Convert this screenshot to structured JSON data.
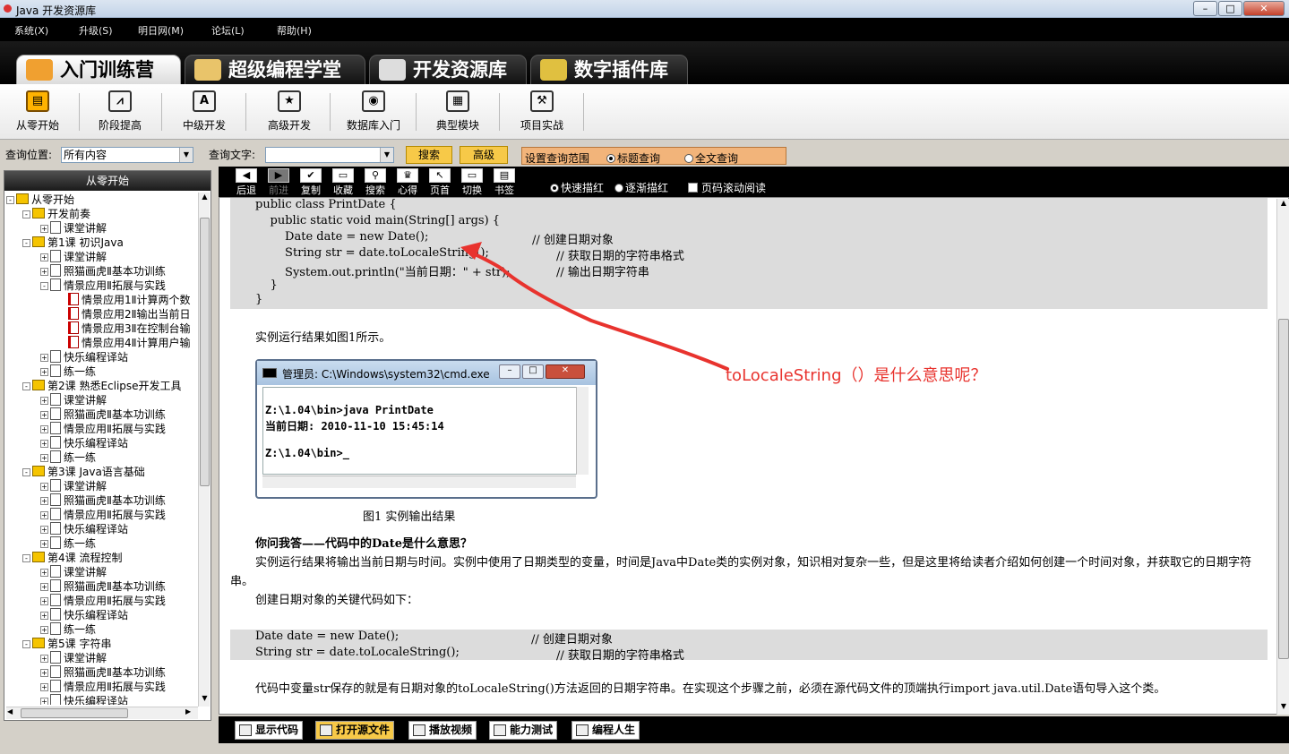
{
  "window": {
    "title": "Java 开发资源库",
    "controls": [
      "–",
      "□",
      "✕"
    ]
  },
  "menubar": {
    "items": [
      "系统(X)",
      "升级(S)",
      "明日网(M)",
      "论坛(L)",
      "帮助(H)"
    ]
  },
  "main_tabs": [
    {
      "label": "入门训练营",
      "active": true
    },
    {
      "label": "超级编程学堂",
      "active": false
    },
    {
      "label": "开发资源库",
      "active": false
    },
    {
      "label": "数字插件库",
      "active": false
    }
  ],
  "toolbar": {
    "buttons": [
      {
        "label": "从零开始",
        "icon": "book-icon",
        "glyph": "▤",
        "active": true
      },
      {
        "label": "阶段提高",
        "icon": "chart-icon",
        "glyph": "⩘"
      },
      {
        "label": "中级开发",
        "icon": "document-icon",
        "glyph": "A"
      },
      {
        "label": "高级开发",
        "icon": "stars-icon",
        "glyph": "★"
      },
      {
        "label": "数据库入门",
        "icon": "database-icon",
        "glyph": "◉"
      },
      {
        "label": "典型模块",
        "icon": "module-icon",
        "glyph": "▦"
      },
      {
        "label": "项目实战",
        "icon": "tools-icon",
        "glyph": "⚒"
      }
    ]
  },
  "search": {
    "location_label": "查询位置:",
    "location_value": "所有内容",
    "text_label": "查询文字:",
    "text_value": "",
    "search_button": "搜索",
    "advanced_button": "高级",
    "scope_label": "设置查询范围",
    "scope_options": [
      {
        "label": "标题查询",
        "selected": true
      },
      {
        "label": "全文查询",
        "selected": false
      }
    ]
  },
  "left_panel": {
    "header": "从零开始",
    "tree": [
      {
        "level": 0,
        "toggle": "-",
        "icon": "home",
        "text": "从零开始"
      },
      {
        "level": 1,
        "toggle": "-",
        "icon": "book",
        "text": "开发前奏"
      },
      {
        "level": 2,
        "toggle": "+",
        "icon": "doc",
        "text": "课堂讲解"
      },
      {
        "level": 1,
        "toggle": "-",
        "icon": "book",
        "text": "第1课  初识Java"
      },
      {
        "level": 2,
        "toggle": "+",
        "icon": "doc",
        "text": "课堂讲解"
      },
      {
        "level": 2,
        "toggle": "+",
        "icon": "doc",
        "text": "照猫画虎Ⅱ基本功训练"
      },
      {
        "level": 2,
        "toggle": "-",
        "icon": "doc",
        "text": "情景应用Ⅱ拓展与实践"
      },
      {
        "level": 3,
        "toggle": "",
        "icon": "red",
        "text": "情景应用1Ⅱ计算两个数"
      },
      {
        "level": 3,
        "toggle": "",
        "icon": "red",
        "text": "情景应用2Ⅱ输出当前日"
      },
      {
        "level": 3,
        "toggle": "",
        "icon": "red",
        "text": "情景应用3Ⅱ在控制台输"
      },
      {
        "level": 3,
        "toggle": "",
        "icon": "red",
        "text": "情景应用4Ⅱ计算用户输"
      },
      {
        "level": 2,
        "toggle": "+",
        "icon": "doc",
        "text": "快乐编程译站"
      },
      {
        "level": 2,
        "toggle": "+",
        "icon": "doc",
        "text": "练一练"
      },
      {
        "level": 1,
        "toggle": "-",
        "icon": "book",
        "text": "第2课  熟悉Eclipse开发工具"
      },
      {
        "level": 2,
        "toggle": "+",
        "icon": "doc",
        "text": "课堂讲解"
      },
      {
        "level": 2,
        "toggle": "+",
        "icon": "doc",
        "text": "照猫画虎Ⅱ基本功训练"
      },
      {
        "level": 2,
        "toggle": "+",
        "icon": "doc",
        "text": "情景应用Ⅱ拓展与实践"
      },
      {
        "level": 2,
        "toggle": "+",
        "icon": "doc",
        "text": "快乐编程译站"
      },
      {
        "level": 2,
        "toggle": "+",
        "icon": "doc",
        "text": "练一练"
      },
      {
        "level": 1,
        "toggle": "-",
        "icon": "book",
        "text": "第3课  Java语言基础"
      },
      {
        "level": 2,
        "toggle": "+",
        "icon": "doc",
        "text": "课堂讲解"
      },
      {
        "level": 2,
        "toggle": "+",
        "icon": "doc",
        "text": "照猫画虎Ⅱ基本功训练"
      },
      {
        "level": 2,
        "toggle": "+",
        "icon": "doc",
        "text": "情景应用Ⅱ拓展与实践"
      },
      {
        "level": 2,
        "toggle": "+",
        "icon": "doc",
        "text": "快乐编程译站"
      },
      {
        "level": 2,
        "toggle": "+",
        "icon": "doc",
        "text": "练一练"
      },
      {
        "level": 1,
        "toggle": "-",
        "icon": "book",
        "text": "第4课  流程控制"
      },
      {
        "level": 2,
        "toggle": "+",
        "icon": "doc",
        "text": "课堂讲解"
      },
      {
        "level": 2,
        "toggle": "+",
        "icon": "doc",
        "text": "照猫画虎Ⅱ基本功训练"
      },
      {
        "level": 2,
        "toggle": "+",
        "icon": "doc",
        "text": "情景应用Ⅱ拓展与实践"
      },
      {
        "level": 2,
        "toggle": "+",
        "icon": "doc",
        "text": "快乐编程译站"
      },
      {
        "level": 2,
        "toggle": "+",
        "icon": "doc",
        "text": "练一练"
      },
      {
        "level": 1,
        "toggle": "-",
        "icon": "book",
        "text": "第5课  字符串"
      },
      {
        "level": 2,
        "toggle": "+",
        "icon": "doc",
        "text": "课堂讲解"
      },
      {
        "level": 2,
        "toggle": "+",
        "icon": "doc",
        "text": "照猫画虎Ⅱ基本功训练"
      },
      {
        "level": 2,
        "toggle": "+",
        "icon": "doc",
        "text": "情景应用Ⅱ拓展与实践"
      },
      {
        "level": 2,
        "toggle": "+",
        "icon": "doc",
        "text": "快乐编程译站"
      }
    ]
  },
  "viewer_toolbar": {
    "buttons": [
      {
        "label": "后退",
        "glyph": "◀"
      },
      {
        "label": "前进",
        "glyph": "▶",
        "disabled": true
      },
      {
        "label": "复制",
        "glyph": "✔"
      },
      {
        "label": "收藏",
        "glyph": "▭"
      },
      {
        "label": "搜索",
        "glyph": "⚲"
      },
      {
        "label": "心得",
        "glyph": "♛"
      },
      {
        "label": "页首",
        "glyph": "↖"
      },
      {
        "label": "切换",
        "glyph": "▭"
      },
      {
        "label": "书签",
        "glyph": "▤"
      }
    ],
    "options": [
      {
        "label": "快速描红",
        "type": "radio",
        "selected": true
      },
      {
        "label": "逐渐描红",
        "type": "radio",
        "selected": false
      },
      {
        "label": "页码滚动阅读",
        "type": "checkbox",
        "selected": false
      }
    ]
  },
  "content": {
    "code1": [
      "public class PrintDate {",
      "    public static void main(String[] args) {",
      "        Date date = new Date();",
      "        String str = date.toLocaleString();",
      "        System.out.println(\"当前日期：\" + str);",
      "    }",
      "}"
    ],
    "code1_comments": [
      "// 创建日期对象",
      "// 获取日期的字符串格式",
      "// 输出日期字符串"
    ],
    "run_intro": "实例运行结果如图1所示。",
    "cmd_window": {
      "title": "管理员: C:\\Windows\\system32\\cmd.exe",
      "lines": [
        "Z:\\1.04\\bin>java PrintDate",
        "当前日期: 2010-11-10 15:45:14",
        "",
        "Z:\\1.04\\bin>_"
      ]
    },
    "figure_caption": "图1  实例输出结果",
    "qa_title": "你问我答——代码中的Date是什么意思？",
    "qa_para": "实例运行结果将输出当前日期与时间。实例中使用了日期类型的变量，时间是Java中Date类的实例对象，知识相对复杂一些，但是这里将给读者介绍如何创建一个时间对象，并获取它的日期字符串。",
    "key_code_intro": "创建日期对象的关键代码如下：",
    "code2": [
      "Date date = new Date();",
      "String str = date.toLocaleString();"
    ],
    "code2_comments": [
      "// 创建日期对象",
      "// 获取日期的字符串格式"
    ],
    "explain_para": "代码中变量str保存的就是有日期对象的toLocaleString()方法返回的日期字符串。在实现这个步骤之前，必须在源代码文件的顶端执行import java.util.Date语句导入这个类。"
  },
  "annotation": {
    "text": "toLocaleString（）是什么意思呢？",
    "color": "#e8332e"
  },
  "bottom_bar": {
    "buttons": [
      {
        "label": "显示代码",
        "active": false,
        "icon": "code-icon"
      },
      {
        "label": "打开源文件",
        "active": true,
        "icon": "folder-icon"
      },
      {
        "label": "播放视频",
        "active": false,
        "icon": "video-icon"
      },
      {
        "label": "能力测试",
        "active": false,
        "icon": "test-icon"
      },
      {
        "label": "编程人生",
        "active": false,
        "icon": "person-icon"
      }
    ]
  }
}
